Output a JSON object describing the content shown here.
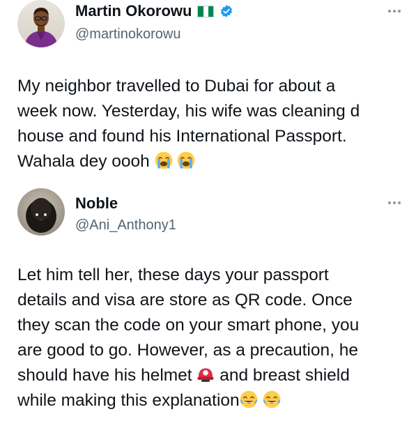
{
  "posts": [
    {
      "display_name": "Martin Okorowu",
      "handle": "@martinokorowu",
      "flag_icon": "nigeria-flag-icon",
      "verified_icon": "verified-badge-icon",
      "verified_color": "#1d9bf0",
      "text_lines": [
        "My neighbor travelled to Dubai for about a",
        "week now. Yesterday, his wife was cleaning d",
        "house and found his International Passport.",
        "Wahala dey oooh"
      ],
      "trailing_emojis": [
        "loudly-crying-face-emoji",
        "loudly-crying-face-emoji"
      ]
    },
    {
      "display_name": "Noble",
      "handle": "@Ani_Anthony1",
      "text_lines": [
        "Let him tell her, these days your passport",
        "details and visa are store as QR code. Once",
        "they scan the code on your smart phone, you",
        "are good to go. However, as a precaution, he",
        "should have his helmet",
        "and breast shield",
        "while making this explanation"
      ],
      "inline_emoji": "rescue-worker-helmet-emoji",
      "trailing_emojis": [
        "face-with-tears-of-joy-emoji",
        "face-with-tears-of-joy-emoji"
      ]
    }
  ],
  "more_icon": "more-options-icon",
  "colors": {
    "name": "#0f1419",
    "handle": "#536471",
    "verified": "#1d9bf0",
    "nigeria_green": "#008751"
  }
}
